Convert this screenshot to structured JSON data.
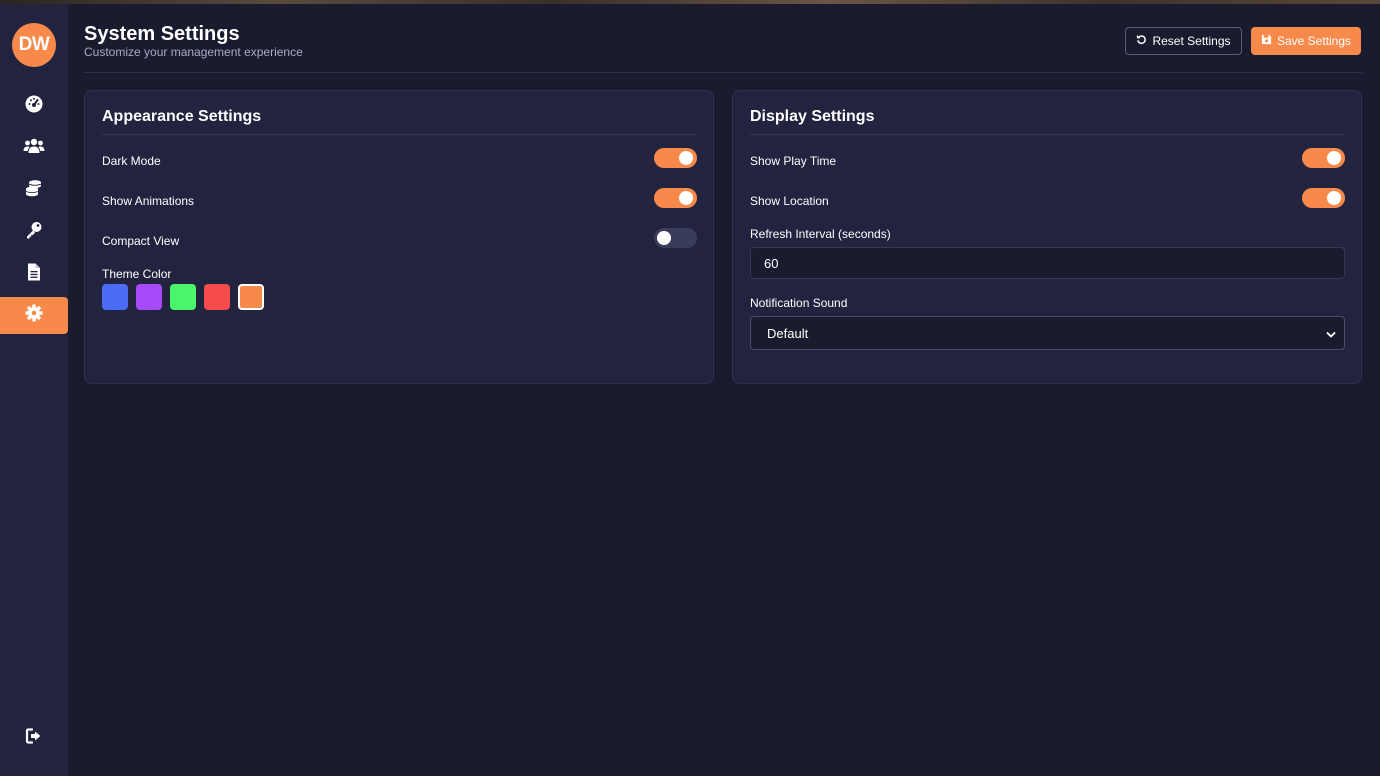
{
  "sidebar": {
    "avatar_initials": "DW",
    "items": [
      {
        "icon": "dashboard-icon",
        "active": false
      },
      {
        "icon": "users-icon",
        "active": false
      },
      {
        "icon": "coins-icon",
        "active": false
      },
      {
        "icon": "key-icon",
        "active": false
      },
      {
        "icon": "document-icon",
        "active": false
      },
      {
        "icon": "settings-icon",
        "active": true
      }
    ],
    "logout_icon": "logout-icon"
  },
  "header": {
    "title": "System Settings",
    "subtitle": "Customize your management experience",
    "reset_label": "Reset Settings",
    "save_label": "Save Settings"
  },
  "appearance": {
    "title": "Appearance Settings",
    "dark_mode": {
      "label": "Dark Mode",
      "enabled": true
    },
    "animations": {
      "label": "Show Animations",
      "enabled": true
    },
    "compact": {
      "label": "Compact View",
      "enabled": false
    },
    "theme_label": "Theme Color",
    "theme_colors": [
      "#4a6cf7",
      "#a64af7",
      "#4af76a",
      "#f74a4a",
      "#f78a4a"
    ],
    "selected_theme": "#f78a4a"
  },
  "display": {
    "title": "Display Settings",
    "play_time": {
      "label": "Show Play Time",
      "enabled": true
    },
    "location": {
      "label": "Show Location",
      "enabled": true
    },
    "refresh_label": "Refresh Interval (seconds)",
    "refresh_value": "60",
    "sound_label": "Notification Sound",
    "sound_value": "Default"
  },
  "colors": {
    "accent": "#f78a4a",
    "background": "#1a1b2e",
    "panel": "#22233f"
  }
}
